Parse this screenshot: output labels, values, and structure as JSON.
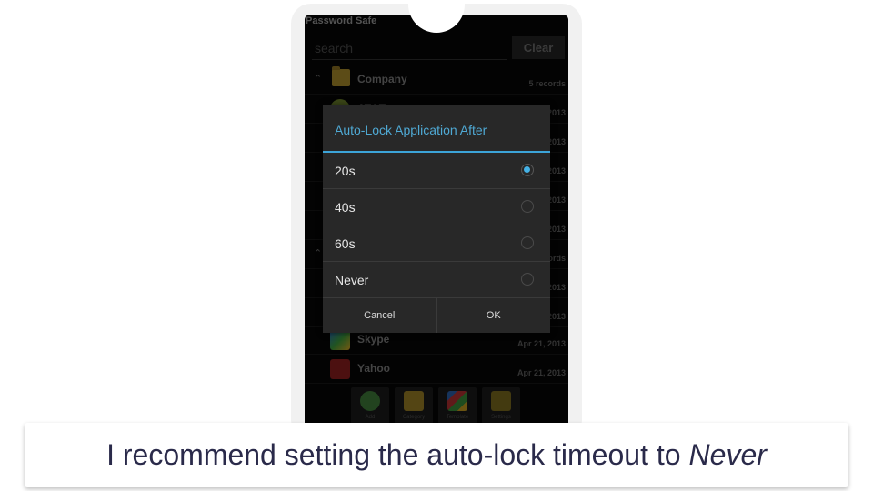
{
  "app": {
    "title": "Password Safe",
    "search_placeholder": "search",
    "clear_label": "Clear"
  },
  "list": {
    "groups": [
      {
        "name": "Company",
        "meta": "5 records",
        "entries": [
          {
            "name": "AT&T",
            "date": "Apr 21, 2013"
          },
          {
            "name": "",
            "date": "Apr 21, 2013"
          },
          {
            "name": "",
            "date": "Apr 21, 2013"
          },
          {
            "name": "",
            "date": "Apr 21, 2013"
          },
          {
            "name": "",
            "date": "Apr 21, 2013"
          }
        ]
      },
      {
        "name": "",
        "meta": "records",
        "entries": [
          {
            "name": "",
            "date": "Apr 21, 2013"
          },
          {
            "name": "",
            "date": "Apr 21, 2013"
          },
          {
            "name": "Skype",
            "date": "Apr 21, 2013"
          },
          {
            "name": "Yahoo",
            "date": "Apr 21, 2013"
          }
        ]
      }
    ]
  },
  "toolbar": {
    "items": [
      {
        "label": "Add",
        "icon": "add-icon"
      },
      {
        "label": "Category",
        "icon": "folder-icon"
      },
      {
        "label": "Template",
        "icon": "puzzle-icon"
      },
      {
        "label": "Settings",
        "icon": "settings-icon"
      }
    ]
  },
  "dialog": {
    "title": "Auto-Lock Application After",
    "options": [
      {
        "label": "20s",
        "selected": true
      },
      {
        "label": "40s",
        "selected": false
      },
      {
        "label": "60s",
        "selected": false
      },
      {
        "label": "Never",
        "selected": false
      }
    ],
    "cancel_label": "Cancel",
    "ok_label": "OK",
    "accent_color": "#3ca4d8"
  },
  "caption": {
    "text": "I recommend setting the auto-lock timeout to",
    "emphasis": "Never"
  }
}
